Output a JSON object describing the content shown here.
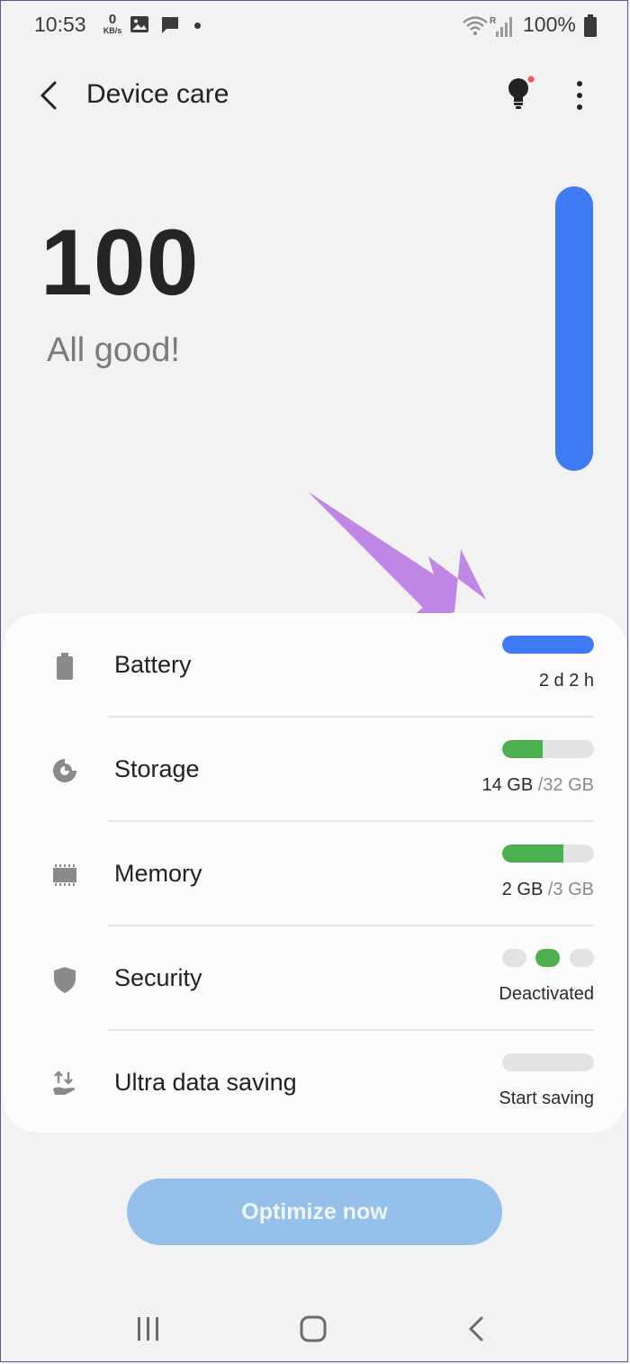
{
  "status_bar": {
    "time": "10:53",
    "net_speed_value": "0",
    "net_speed_unit": "KB/s",
    "battery_percent": "100%",
    "icons": [
      "image-icon",
      "message-icon",
      "notification-dot",
      "wifi-icon",
      "signal-roaming-icon",
      "battery-icon"
    ]
  },
  "header": {
    "title": "Device care",
    "back_icon": "back-arrow-icon",
    "tips_icon": "lightbulb-icon",
    "menu_icon": "more-vertical-icon"
  },
  "score": {
    "value": "100",
    "message": "All good!",
    "level": 1.0,
    "bar_color": "#3e7af3"
  },
  "items": [
    {
      "label": "Battery",
      "icon": "battery-icon",
      "value": "2 d 2 h",
      "sub": "",
      "level": 1.0,
      "color": "#3e7af3"
    },
    {
      "label": "Storage",
      "icon": "storage-pie-icon",
      "value": "14 GB",
      "sub": "/32 GB",
      "level": 0.4375,
      "color": "#4caf50"
    },
    {
      "label": "Memory",
      "icon": "memory-chip-icon",
      "value": "2 GB",
      "sub": "/3 GB",
      "level": 0.6667,
      "color": "#4caf50"
    },
    {
      "label": "Security",
      "icon": "shield-icon",
      "value": "Deactivated",
      "sub": "",
      "active_pill": 2,
      "color": "#4caf50"
    },
    {
      "label": "Ultra data saving",
      "icon": "data-saving-icon",
      "value": "Start saving",
      "sub": "",
      "level": 0.0,
      "color": "#4caf50"
    }
  ],
  "optimize_button": {
    "label": "Optimize now",
    "color": "#94c0ea"
  },
  "nav_bar": {
    "recents_icon": "recents-icon",
    "home_icon": "home-icon",
    "back_icon": "nav-back-icon"
  },
  "annotation": {
    "arrow_color": "#bf86e6"
  }
}
